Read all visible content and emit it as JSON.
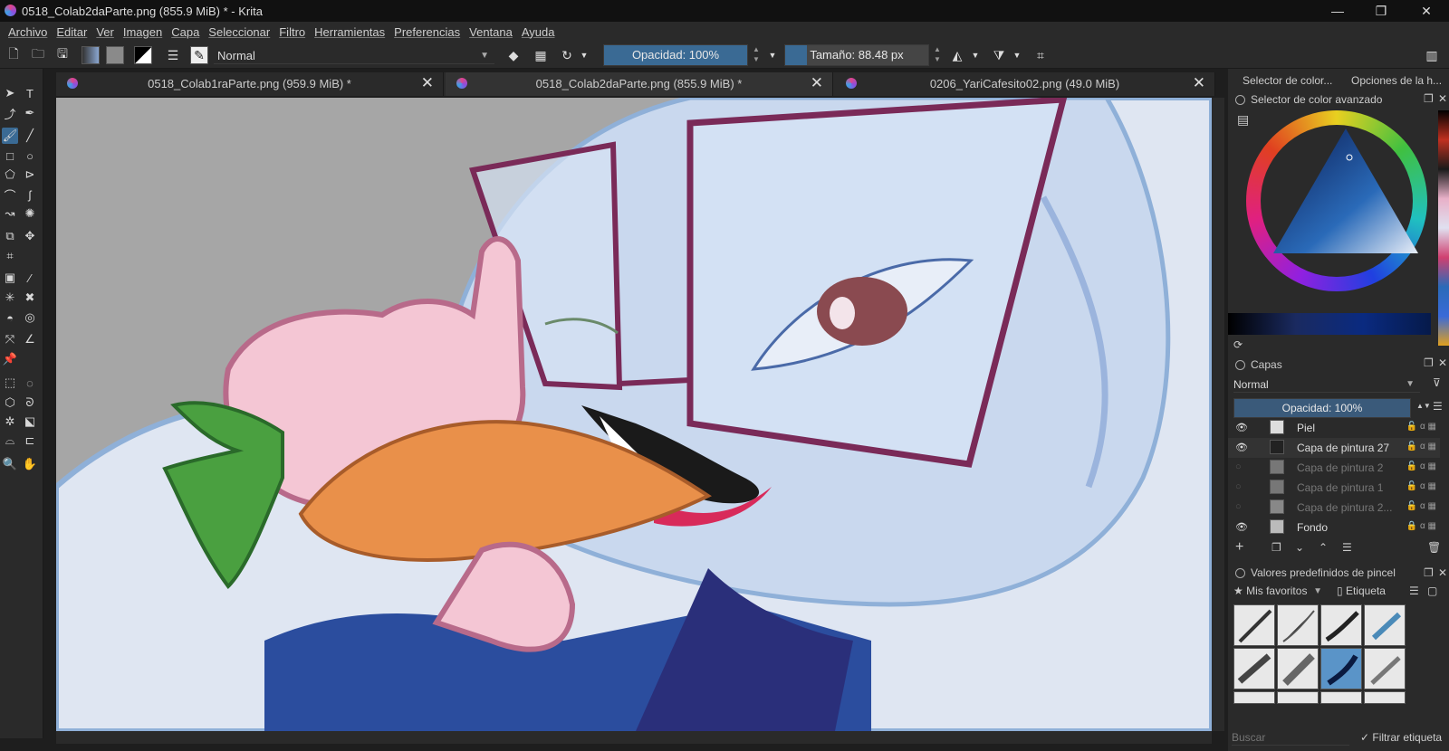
{
  "window": {
    "title": "0518_Colab2daParte.png (855.9 MiB) * - Krita",
    "minimize": "—",
    "restore": "❐",
    "close": "✕"
  },
  "menu": [
    "Archivo",
    "Editar",
    "Ver",
    "Imagen",
    "Capa",
    "Seleccionar",
    "Filtro",
    "Herramientas",
    "Preferencias",
    "Ventana",
    "Ayuda"
  ],
  "toolbar": {
    "blend_mode": "Normal",
    "opacity_label": "Opacidad: 100%",
    "opacity_value": 1.0,
    "size_label": "Tamaño: 88.48 px",
    "size_value": 0.15
  },
  "tabs": [
    {
      "label": "0518_Colab1raParte.png (959.9 MiB) *",
      "close": "✕"
    },
    {
      "label": "0518_Colab2daParte.png (855.9 MiB) *",
      "close": "✕"
    },
    {
      "label": "0206_YariCafesito02.png (49.0 MiB)",
      "close": "✕"
    }
  ],
  "dock": {
    "tabs": [
      "Selector de color...",
      "Opciones de la h..."
    ],
    "color_selector_title": "Selector de color avanzado",
    "layers_title": "Capas",
    "layers_blend": "Normal",
    "layers_opacity": "Opacidad: 100%",
    "layers": [
      {
        "name": "Piel",
        "visible": true
      },
      {
        "name": "Capa de pintura 27",
        "visible": true
      },
      {
        "name": "Capa de pintura 2",
        "visible": false
      },
      {
        "name": "Capa de pintura 1",
        "visible": false
      },
      {
        "name": "Capa de pintura 2...",
        "visible": false
      },
      {
        "name": "Fondo",
        "visible": true
      }
    ],
    "brush_presets_title": "Valores predefinidos de pincel",
    "favorites": "Mis favoritos",
    "tag": "Etiqueta",
    "search_placeholder": "Buscar",
    "filter_tag": "Filtrar etiqueta"
  },
  "colors": {
    "accent": "#3a6a94",
    "background": "#2a2a2a"
  }
}
